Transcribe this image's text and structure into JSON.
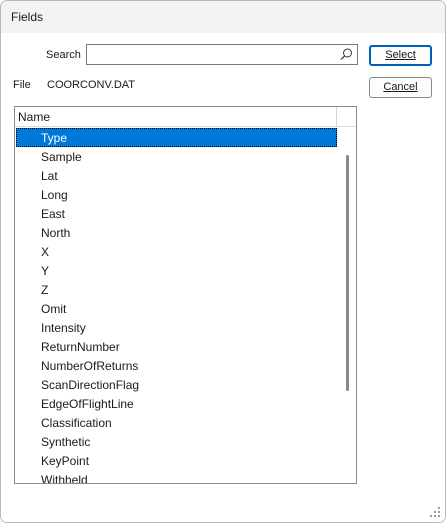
{
  "window": {
    "title": "Fields"
  },
  "search": {
    "label": "Search",
    "value": "",
    "placeholder": ""
  },
  "file": {
    "label": "File",
    "value": "COORCONV.DAT"
  },
  "buttons": {
    "select": "Select",
    "cancel": "Cancel"
  },
  "list": {
    "header": "Name",
    "selected_index": 0,
    "items": [
      "Type",
      "Sample",
      "Lat",
      "Long",
      "East",
      "North",
      "X",
      "Y",
      "Z",
      "Omit",
      "Intensity",
      "ReturnNumber",
      "NumberOfReturns",
      "ScanDirectionFlag",
      "EdgeOfFlightLine",
      "Classification",
      "Synthetic",
      "KeyPoint",
      "Withheld"
    ]
  },
  "colors": {
    "selection": "#0078d7",
    "accent_border": "#005fb8"
  }
}
